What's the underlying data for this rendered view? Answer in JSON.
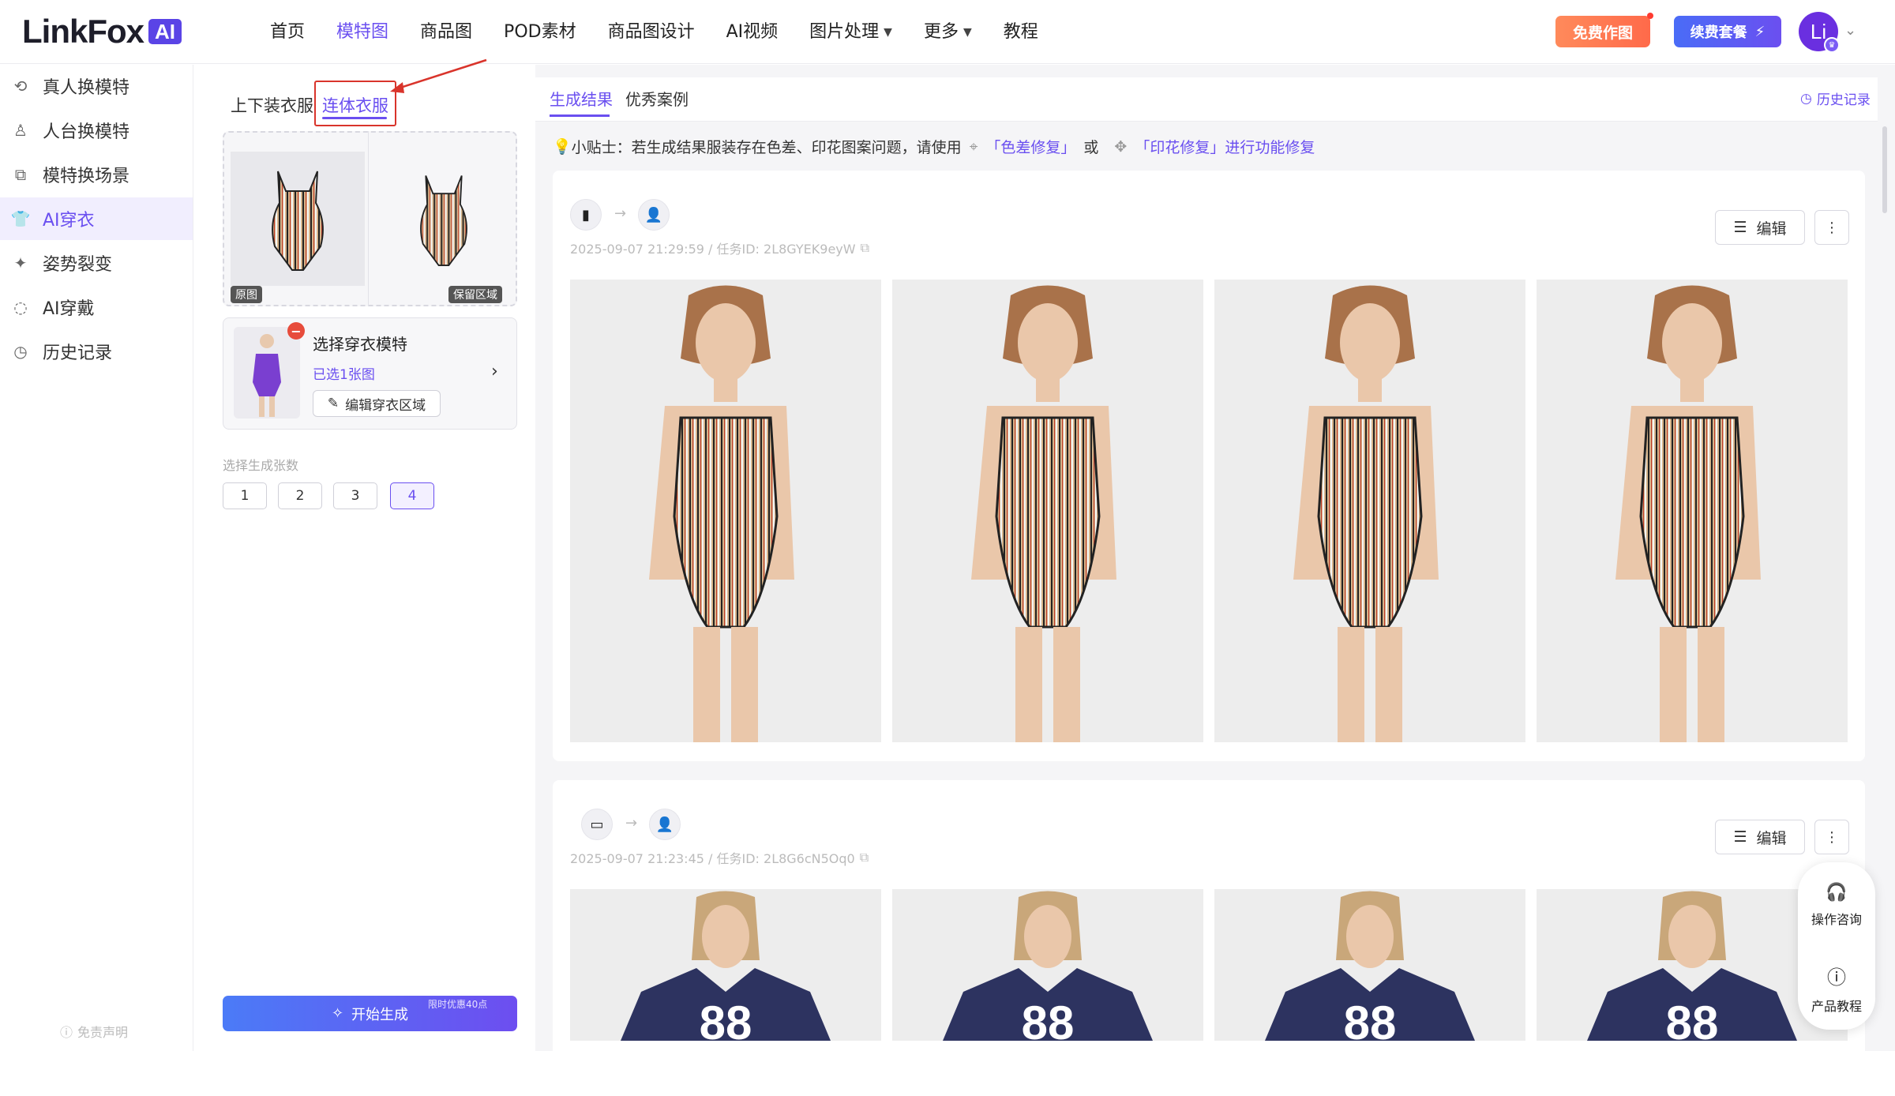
{
  "brand": {
    "name": "LinkFox",
    "badge": "AI"
  },
  "nav": {
    "items": [
      {
        "label": "首页"
      },
      {
        "label": "模特图",
        "active": true
      },
      {
        "label": "商品图"
      },
      {
        "label": "POD素材"
      },
      {
        "label": "商品图设计"
      },
      {
        "label": "AI视频"
      },
      {
        "label": "图片处理",
        "dropdown": true
      },
      {
        "label": "更多",
        "dropdown": true
      },
      {
        "label": "教程"
      }
    ],
    "free_label": "免费作图",
    "renew_label": "续费套餐",
    "avatar_initials": "Li"
  },
  "sidebar": {
    "items": [
      {
        "label": "真人换模特",
        "icon": "person-swap-icon"
      },
      {
        "label": "人台换模特",
        "icon": "mannequin-icon"
      },
      {
        "label": "模特换场景",
        "icon": "scene-icon"
      },
      {
        "label": "AI穿衣",
        "icon": "shirt-icon",
        "active": true
      },
      {
        "label": "姿势裂变",
        "icon": "pose-icon"
      },
      {
        "label": "AI穿戴",
        "icon": "accessory-icon"
      },
      {
        "label": "历史记录",
        "icon": "history-icon"
      }
    ],
    "disclaimer": "免责声明"
  },
  "panel": {
    "tabs": [
      {
        "label": "上下装衣服"
      },
      {
        "label": "连体衣服",
        "active": true
      }
    ],
    "garment_tags": {
      "original": "原图",
      "keep": "保留区域"
    },
    "model_card": {
      "title": "选择穿衣模特",
      "selected": "已选1张图",
      "edit_label": "编辑穿衣区域"
    },
    "count_label": "选择生成张数",
    "count_options": [
      "1",
      "2",
      "3",
      "4"
    ],
    "count_selected": "4",
    "generate_label": "开始生成",
    "generate_badge": "限时优惠40点"
  },
  "main": {
    "tabs": [
      {
        "label": "生成结果",
        "active": true
      },
      {
        "label": "优秀案例"
      }
    ],
    "history_link": "历史记录",
    "tip": {
      "prefix": "小贴士：若生成结果服装存在色差、印花图案问题，请使用",
      "link1": "「色差修复」",
      "mid": "或",
      "link2": "「印花修复」进行功能修复"
    },
    "results": [
      {
        "meta": "2025-09-07 21:29:59 / 任务ID: 2L8GYEK9eyW",
        "edit_label": "编辑"
      },
      {
        "meta": "2025-09-07 21:23:45 / 任务ID: 2L8G6cN5Oq0",
        "edit_label": "编辑"
      }
    ]
  },
  "help": {
    "consult": "操作咨询",
    "tutorial": "产品教程"
  },
  "colors": {
    "accent": "#6a4ff0",
    "annotation": "#d9342b",
    "free_btn": "#ff7a52"
  }
}
